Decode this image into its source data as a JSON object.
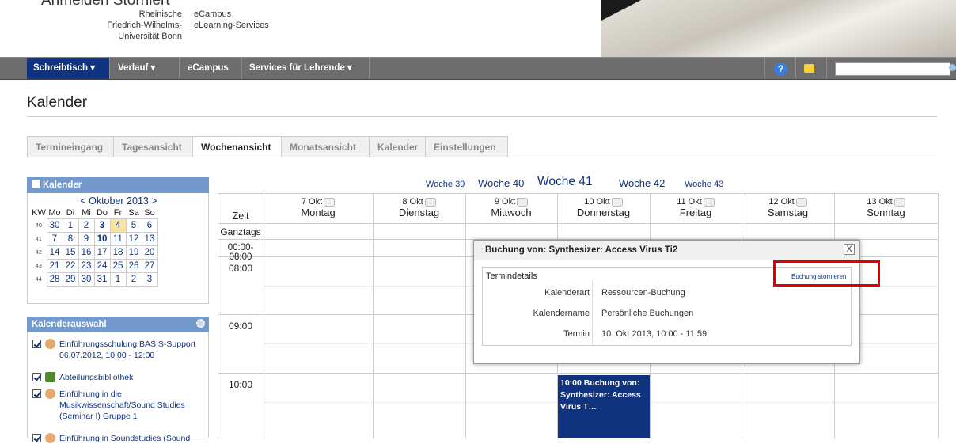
{
  "header": {
    "cut_text": "Anmelden Storniert",
    "university": [
      "Rheinische",
      "Friedrich-Wilhelms-",
      "Universität Bonn"
    ],
    "ecampus": [
      "eCampus",
      "eLearning-Services"
    ]
  },
  "nav": {
    "items": [
      "Schreibtisch ▾",
      "Verlauf ▾",
      "eCampus ▾",
      "Services für Lehrende ▾"
    ],
    "help": "?"
  },
  "page": {
    "title": "Kalender"
  },
  "tabs": [
    "Termineingang",
    "Tagesansicht",
    "Wochenansicht",
    "Monatsansicht",
    "Kalender",
    "Einstellungen"
  ],
  "mini_calendar": {
    "title": "Kalender",
    "month": "< Oktober 2013 >",
    "headers": [
      "KW",
      "Mo",
      "Di",
      "Mi",
      "Do",
      "Fr",
      "Sa",
      "So"
    ],
    "rows": [
      [
        "40",
        "30",
        "1",
        "2",
        "3",
        "4",
        "5",
        "6"
      ],
      [
        "41",
        "7",
        "8",
        "9",
        "10",
        "11",
        "12",
        "13"
      ],
      [
        "42",
        "14",
        "15",
        "16",
        "17",
        "18",
        "19",
        "20"
      ],
      [
        "43",
        "21",
        "22",
        "23",
        "24",
        "25",
        "26",
        "27"
      ],
      [
        "44",
        "28",
        "29",
        "30",
        "31",
        "1",
        "2",
        "3"
      ]
    ]
  },
  "calendar_select": {
    "title": "Kalenderauswahl",
    "items": [
      {
        "text": "Einführungsschulung BASIS-Support 06.07.2012, 10:00 - 12:00",
        "icon": "group-icon"
      },
      {
        "text": "Abteilungsbibliothek",
        "icon": "tree-icon"
      },
      {
        "text": "Einführung in die Musikwissenschaft/Sound Studies (Seminar I) Gruppe 1",
        "icon": "group-icon"
      },
      {
        "text": "Einführung in Soundstudies (Sound",
        "icon": "group-icon"
      }
    ]
  },
  "weeks": [
    "Woche 39",
    "Woche 40",
    "Woche 41",
    "Woche 42",
    "Woche 43"
  ],
  "week_view": {
    "zeit": "Zeit",
    "days": [
      {
        "date": "7 Okt",
        "name": "Montag"
      },
      {
        "date": "8 Okt",
        "name": "Dienstag"
      },
      {
        "date": "9 Okt",
        "name": "Mittwoch"
      },
      {
        "date": "10 Okt",
        "name": "Donnerstag"
      },
      {
        "date": "11 Okt",
        "name": "Freitag"
      },
      {
        "date": "12 Okt",
        "name": "Samstag"
      },
      {
        "date": "13 Okt",
        "name": "Sonntag"
      }
    ],
    "rows": [
      "Ganztags",
      "00:00-08:00",
      "08:00",
      "09:00",
      "10:00"
    ],
    "event": "10:00 Buchung von: Synthesizer: Access Virus T…"
  },
  "popup": {
    "title": "Buchung von: Synthesizer: Access Virus Ti2",
    "close": "X",
    "section": "Termindetails",
    "cancel_link": "Buchung stornieren",
    "fields": [
      {
        "label": "Kalenderart",
        "value": "Ressourcen-Buchung"
      },
      {
        "label": "Kalendername",
        "value": "Persönliche Buchungen"
      },
      {
        "label": "Termin",
        "value": "10. Okt 2013, 10:00 - 11:59"
      }
    ]
  }
}
